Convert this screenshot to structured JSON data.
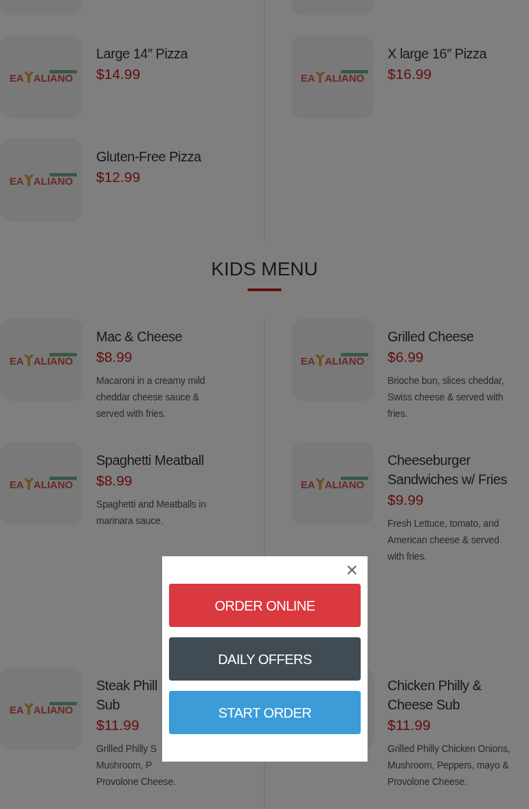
{
  "sections": [
    {
      "items": [
        {
          "kind": "image"
        },
        {
          "kind": "image"
        }
      ]
    },
    {
      "items": [
        {
          "logo": [
            "EA",
            "ALIANO"
          ],
          "name": [
            "Large 14″ Pizza"
          ],
          "price": "$14.99"
        },
        {
          "logo": [
            "EA",
            "ALIANO"
          ],
          "name": [
            "X large 16″ Pizza"
          ],
          "price": "$16.99"
        },
        {
          "logo": [
            "EA",
            "ALIANO"
          ],
          "name": [
            "Gluten-Free Pizza"
          ],
          "price": "$12.99"
        }
      ]
    },
    {
      "title": "KIDS MENU",
      "items": [
        {
          "logo": [
            "EA",
            "ALIANO"
          ],
          "name": [
            "Mac & Cheese"
          ],
          "price": "$8.99",
          "description": [
            "Macaroni in a creamy mild cheddar cheese sauce & served with fries."
          ]
        },
        {
          "logo": [
            "EA",
            "ALIANO"
          ],
          "name": [
            "Grilled Cheese"
          ],
          "price": "$6.99",
          "description": [
            "Brioche bun, slices cheddar, Swiss cheese & served with fries."
          ]
        },
        {
          "logo": [
            "EA",
            "ALIANO"
          ],
          "name": [
            "Spaghetti Meatball"
          ],
          "price": "$8.99",
          "description": [
            "Spaghetti and Meatballs in marinara sauce."
          ]
        },
        {
          "logo": [
            "EA",
            "ALIANO"
          ],
          "name": [
            "Cheeseburger",
            "Sandwiches w/ Fries"
          ],
          "price": "$9.99",
          "description": [
            "Fresh Lettuce, tomato, and American cheese & served with fries."
          ]
        }
      ]
    },
    {
      "items": [
        {
          "logo": [
            "EA",
            "ALIANO"
          ],
          "name": [
            "Steak Phill",
            "Sub"
          ],
          "price": "$11.99",
          "description": [
            "Grilled Philly S",
            "Mushroom, P",
            "Provolone Cheese."
          ]
        },
        {
          "name": [
            "Chicken Philly &",
            "Cheese Sub"
          ],
          "price": "$11.99",
          "description": [
            "Grilled Philly Chicken Onions,",
            "Mushroom, Peppers, mayo &",
            "Provolone Cheese."
          ]
        }
      ]
    }
  ],
  "modal": {
    "close": "×",
    "buttons": [
      {
        "kind": "order",
        "label": "ORDER ONLINE"
      },
      {
        "kind": "offers",
        "label": "DAILY OFFERS"
      },
      {
        "kind": "start",
        "label": "START ORDER"
      }
    ]
  }
}
